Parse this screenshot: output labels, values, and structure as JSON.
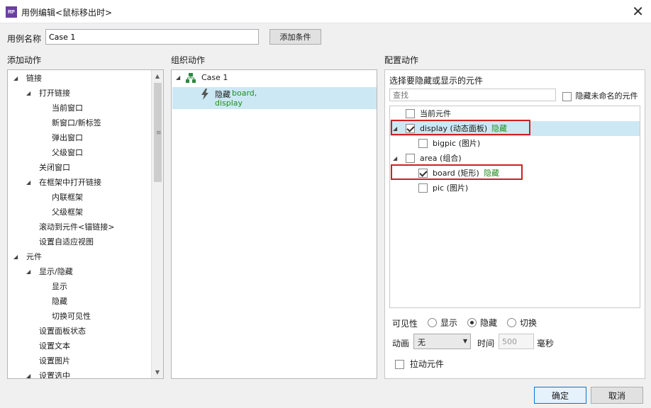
{
  "window": {
    "app_icon_text": "RP",
    "title": "用例编辑<鼠标移出时>",
    "close_glyph": "✕"
  },
  "case": {
    "label": "用例名称",
    "value": "Case 1",
    "add_condition_label": "添加条件"
  },
  "sections": {
    "add_actions": "添加动作",
    "organize_actions": "组织动作",
    "configure_actions": "配置动作"
  },
  "action_tree": [
    {
      "label": "链接",
      "level": 0,
      "expanded": true
    },
    {
      "label": "打开链接",
      "level": 1,
      "expanded": true
    },
    {
      "label": "当前窗口",
      "level": 2
    },
    {
      "label": "新窗口/新标签",
      "level": 2
    },
    {
      "label": "弹出窗口",
      "level": 2
    },
    {
      "label": "父级窗口",
      "level": 2
    },
    {
      "label": "关闭窗口",
      "level": 1
    },
    {
      "label": "在框架中打开链接",
      "level": 1,
      "expanded": true
    },
    {
      "label": "内联框架",
      "level": 2
    },
    {
      "label": "父级框架",
      "level": 2
    },
    {
      "label": "滚动到元件<锚链接>",
      "level": 1
    },
    {
      "label": "设置自适应视图",
      "level": 1
    },
    {
      "label": "元件",
      "level": 0,
      "expanded": true
    },
    {
      "label": "显示/隐藏",
      "level": 1,
      "expanded": true
    },
    {
      "label": "显示",
      "level": 2
    },
    {
      "label": "隐藏",
      "level": 2
    },
    {
      "label": "切换可见性",
      "level": 2
    },
    {
      "label": "设置面板状态",
      "level": 1
    },
    {
      "label": "设置文本",
      "level": 1
    },
    {
      "label": "设置图片",
      "level": 1
    },
    {
      "label": "设置选中",
      "level": 1,
      "expanded": true
    }
  ],
  "organize": {
    "case_name": "Case 1",
    "action_verb": "隐藏",
    "action_targets_line1": "board,",
    "action_targets_line2": "display"
  },
  "configure": {
    "subtitle": "选择要隐藏或显示的元件",
    "search_placeholder": "查找",
    "hide_unnamed_label": "隐藏未命名的元件",
    "widgets": [
      {
        "label": "当前元件",
        "checked": false,
        "indent": 0,
        "caret": false,
        "state": ""
      },
      {
        "label": "display (动态面板)",
        "checked": true,
        "indent": 0,
        "caret": true,
        "state": "隐藏",
        "highlight": true
      },
      {
        "label": "bigpic (图片)",
        "checked": false,
        "indent": 1,
        "caret": false,
        "state": ""
      },
      {
        "label": "area (组合)",
        "checked": false,
        "indent": 0,
        "caret": true,
        "state": ""
      },
      {
        "label": "board (矩形)",
        "checked": true,
        "indent": 1,
        "caret": false,
        "state": "隐藏"
      },
      {
        "label": "pic (图片)",
        "checked": false,
        "indent": 1,
        "caret": false,
        "state": ""
      }
    ],
    "visibility_label": "可见性",
    "visibility_options": [
      "显示",
      "隐藏",
      "切换"
    ],
    "visibility_selected": "隐藏",
    "animation_label": "动画",
    "animation_value": "无",
    "time_label": "时间",
    "time_value": "500",
    "time_unit": "毫秒",
    "drag_widget_label": "拉动元件"
  },
  "footer": {
    "ok_label": "确定",
    "cancel_label": "取消"
  },
  "colors": {
    "selection": "#cce8f4",
    "state_text": "#1f8f1f",
    "highlight_border": "#d02020"
  }
}
